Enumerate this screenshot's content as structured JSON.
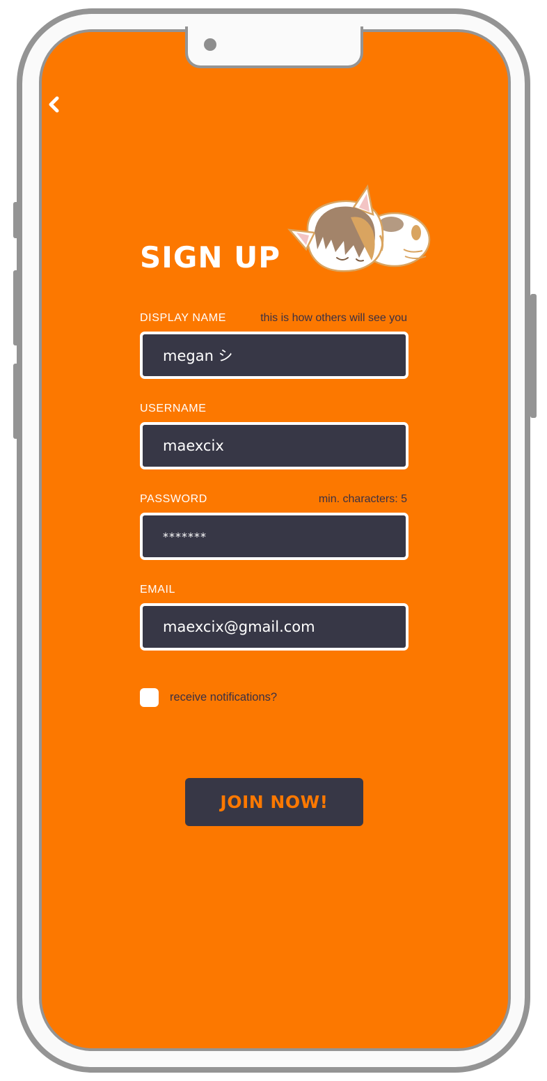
{
  "nav": {
    "back_icon": "chevron-left-icon"
  },
  "header": {
    "title": "SIGN UP",
    "illustration": "sleeping-cat-illustration"
  },
  "form": {
    "display_name": {
      "label": "DISPLAY NAME",
      "hint": "this is how others will see you",
      "value": "megan シ"
    },
    "username": {
      "label": "USERNAME",
      "value": "maexcix"
    },
    "password": {
      "label": "PASSWORD",
      "hint": "min. characters: 5",
      "value": "*******"
    },
    "email": {
      "label": "EMAIL",
      "value": "maexcix@gmail.com"
    },
    "notifications": {
      "label": "receive notifications?",
      "checked": false
    },
    "submit_label": "JOIN NOW!"
  },
  "colors": {
    "background": "#fc7800",
    "input_fill": "#373746",
    "input_border": "#ffffff",
    "label_text": "#ffffff",
    "hint_text": "#3a3044",
    "button_fill": "#373746",
    "button_text": "#fc7800",
    "frame": "#949494"
  }
}
